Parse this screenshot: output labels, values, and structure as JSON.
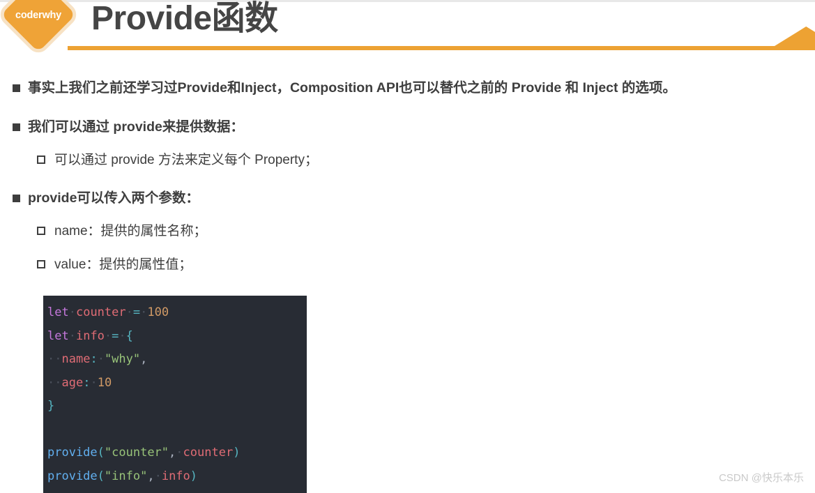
{
  "header": {
    "title": "Provide函数",
    "logo_text": "coderwhy",
    "accent_color": "#eda233",
    "title_color": "#454545"
  },
  "bullets": [
    {
      "level": 1,
      "marker": "filled-square",
      "text": "事实上我们之前还学习过Provide和Inject，Composition API也可以替代之前的 Provide 和 Inject 的选项。"
    },
    {
      "level": 1,
      "marker": "filled-square",
      "text": "我们可以通过 provide来提供数据："
    },
    {
      "level": 2,
      "marker": "hollow-square",
      "text": "可以通过 provide 方法来定义每个 Property；"
    },
    {
      "level": 1,
      "marker": "filled-square",
      "text": "provide可以传入两个参数："
    },
    {
      "level": 2,
      "marker": "hollow-square",
      "text": "name：提供的属性名称；"
    },
    {
      "level": 2,
      "marker": "hollow-square",
      "text": "value：提供的属性值；"
    }
  ],
  "code_block": {
    "language": "javascript",
    "background": "#282c34",
    "lines": [
      "let counter = 100",
      "let info = {",
      "  name: \"why\",",
      "  age: 10",
      "}",
      "",
      "provide(\"counter\", counter)",
      "provide(\"info\", info)"
    ]
  },
  "watermark": {
    "text": "CSDN @快乐本乐"
  }
}
